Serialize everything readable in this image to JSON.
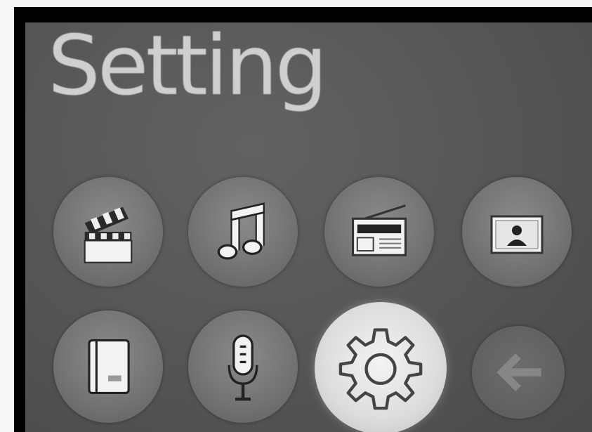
{
  "screen": {
    "title": "Setting"
  },
  "menu": {
    "items": [
      {
        "id": "movie",
        "icon": "clapperboard-icon",
        "selected": false
      },
      {
        "id": "music",
        "icon": "music-note-icon",
        "selected": false
      },
      {
        "id": "radio",
        "icon": "radio-icon",
        "selected": false
      },
      {
        "id": "photo",
        "icon": "photo-icon",
        "selected": false
      },
      {
        "id": "ebook",
        "icon": "book-icon",
        "selected": false
      },
      {
        "id": "voice",
        "icon": "microphone-icon",
        "selected": false
      },
      {
        "id": "setting",
        "icon": "gear-icon",
        "selected": true
      },
      {
        "id": "back",
        "icon": "back-arrow-icon",
        "selected": false
      }
    ]
  },
  "colors": {
    "background": "#555555",
    "title": "#cfcfcf",
    "selected_button": "#e2e2e2"
  }
}
